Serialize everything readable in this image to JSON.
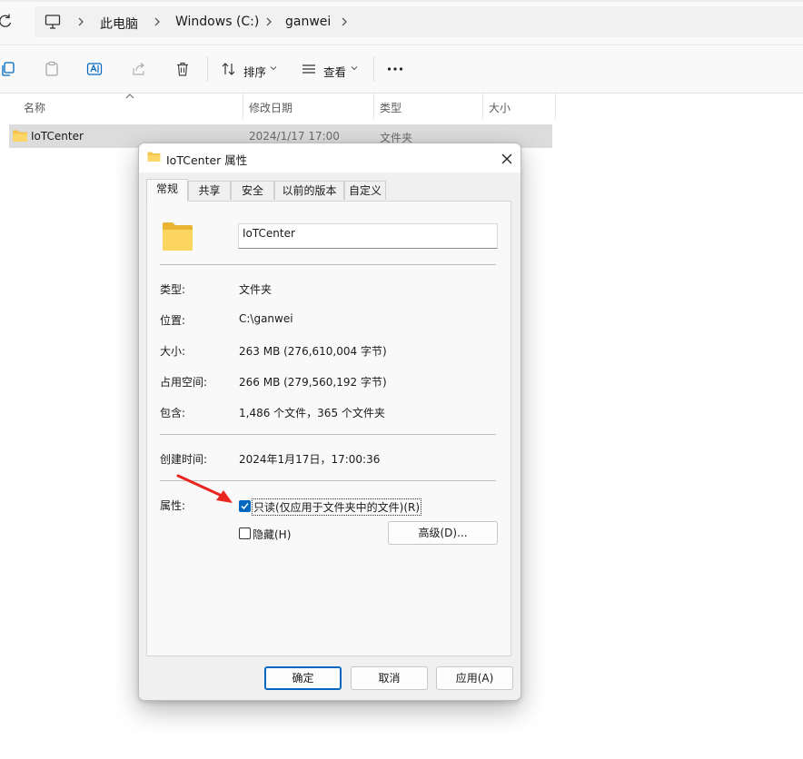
{
  "address_bar": {
    "segments": [
      "此电脑",
      "Windows (C:)",
      "ganwei"
    ]
  },
  "toolbar": {
    "sort_label": "排序",
    "view_label": "查看",
    "more_label": "..."
  },
  "file_list": {
    "columns": [
      "名称",
      "修改日期",
      "类型",
      "大小"
    ],
    "rows": [
      {
        "name": "IoTCenter",
        "modified": "2024/1/17 17:00",
        "type": "文件夹",
        "size": ""
      }
    ]
  },
  "dialog": {
    "title": "IoTCenter 属性",
    "tabs": [
      "常规",
      "共享",
      "安全",
      "以前的版本",
      "自定义"
    ],
    "active_tab": "常规",
    "name_value": "IoTCenter",
    "properties": [
      {
        "label": "类型:",
        "value": "文件夹"
      },
      {
        "label": "位置:",
        "value": "C:\\ganwei"
      },
      {
        "label": "大小:",
        "value": "263 MB (276,610,004 字节)"
      },
      {
        "label": "占用空间:",
        "value": "266 MB (279,560,192 字节)"
      },
      {
        "label": "包含:",
        "value": "1,486 个文件，365 个文件夹"
      }
    ],
    "created_label": "创建时间:",
    "created_value": "2024年1月17日，17:00:36",
    "attributes_label": "属性:",
    "readonly_label": "只读(仅应用于文件夹中的文件)(R)",
    "readonly_checked": true,
    "hidden_label": "隐藏(H)",
    "hidden_checked": false,
    "advanced_label": "高级(D)...",
    "ok_label": "确定",
    "cancel_label": "取消",
    "apply_label": "应用(A)"
  },
  "colors": {
    "accent": "#0067c0",
    "annotation_arrow": "#e8261f",
    "folder_yellow": "#f8cf4f"
  }
}
